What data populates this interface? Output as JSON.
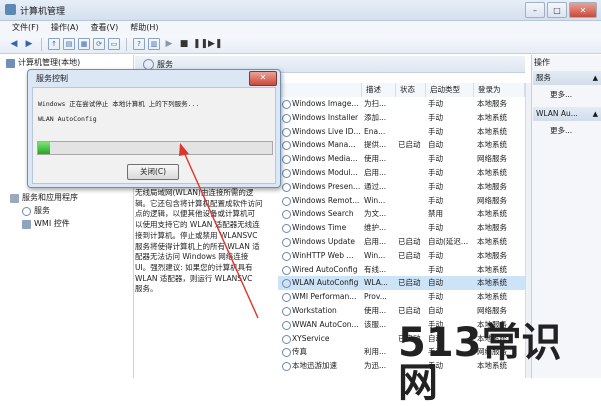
{
  "window": {
    "title": "计算机管理"
  },
  "menu": [
    "文件(F)",
    "操作(A)",
    "查看(V)",
    "帮助(H)"
  ],
  "tree": {
    "root": "计算机管理(本地)",
    "items": [
      "服务和应用程序",
      "服务",
      "WMI 控件"
    ]
  },
  "services_panel": {
    "header": "服务",
    "description": [
      "无线局域网(WLAN)由连接所需的逻",
      "辑。它还包含将计算机配置成软件访问",
      "点的逻辑，以便其他设备或计算机可",
      "以使用支持它的 WLAN 适配器无线连",
      "接到计算机。停止或禁用 WLANSVC",
      "服务将使得计算机上的所有 WLAN 适",
      "配器无法访问 Windows 网络连接",
      "UI。强烈建议: 如果您的计算机具有",
      "WLAN 适配器，则运行 WLANSVC",
      "服务。"
    ],
    "columns": [
      "描述",
      "状态",
      "启动类型",
      "登录为"
    ]
  },
  "services": [
    {
      "name": "Windows Image...",
      "desc": "为扫...",
      "status": "",
      "startup": "手动",
      "logon": "本地服务"
    },
    {
      "name": "Windows Installer",
      "desc": "添加...",
      "status": "",
      "startup": "手动",
      "logon": "本地系统"
    },
    {
      "name": "Windows Live ID...",
      "desc": "Ena...",
      "status": "",
      "startup": "手动",
      "logon": "本地系统"
    },
    {
      "name": "Windows Mana...",
      "desc": "提供...",
      "status": "已启动",
      "startup": "自动",
      "logon": "本地系统"
    },
    {
      "name": "Windows Media...",
      "desc": "使用...",
      "status": "",
      "startup": "手动",
      "logon": "网络服务"
    },
    {
      "name": "Windows Modul...",
      "desc": "启用...",
      "status": "",
      "startup": "手动",
      "logon": "本地系统"
    },
    {
      "name": "Windows Presen...",
      "desc": "通过...",
      "status": "",
      "startup": "手动",
      "logon": "本地服务"
    },
    {
      "name": "Windows Remot...",
      "desc": "Win...",
      "status": "",
      "startup": "手动",
      "logon": "网络服务"
    },
    {
      "name": "Windows Search",
      "desc": "为文...",
      "status": "",
      "startup": "禁用",
      "logon": "本地系统"
    },
    {
      "name": "Windows Time",
      "desc": "维护...",
      "status": "",
      "startup": "手动",
      "logon": "本地服务"
    },
    {
      "name": "Windows Update",
      "desc": "启用...",
      "status": "已启动",
      "startup": "自动(延迟...",
      "logon": "本地系统"
    },
    {
      "name": "WinHTTP Web ...",
      "desc": "Win...",
      "status": "已启动",
      "startup": "手动",
      "logon": "本地服务"
    },
    {
      "name": "Wired AutoConfig",
      "desc": "有线...",
      "status": "",
      "startup": "手动",
      "logon": "本地系统"
    },
    {
      "name": "WLAN AutoConfig",
      "desc": "WLA...",
      "status": "已启动",
      "startup": "自动",
      "logon": "本地系统"
    },
    {
      "name": "WMI Performan...",
      "desc": "Prov...",
      "status": "",
      "startup": "手动",
      "logon": "本地系统"
    },
    {
      "name": "Workstation",
      "desc": "使用...",
      "status": "已启动",
      "startup": "自动",
      "logon": "网络服务"
    },
    {
      "name": "WWAN AutoCon...",
      "desc": "该服...",
      "status": "",
      "startup": "手动",
      "logon": "本地服务"
    },
    {
      "name": "XYService",
      "desc": "",
      "status": "已启动",
      "startup": "自动",
      "logon": "本地系统"
    },
    {
      "name": "传真",
      "desc": "利用...",
      "status": "",
      "startup": "手动",
      "logon": "网络服务"
    },
    {
      "name": "本地迅游加速",
      "desc": "为迅...",
      "status": "",
      "startup": "手动",
      "logon": "本地系统"
    }
  ],
  "selected_service_index": 13,
  "actions": {
    "title": "操作",
    "group1": "服务",
    "more1": "更多...",
    "group2": "WLAN Au...",
    "more2": "更多..."
  },
  "dialog": {
    "title": "服务控制",
    "line1": "Windows 正在尝试停止 本地计算机 上的下列服务...",
    "line2": "WLAN AutoConfig",
    "progress": 0.05,
    "button": "关闭(C)"
  },
  "watermark": "513常识网",
  "colors": {
    "accent": "#3266a8",
    "selection": "#cde3f7",
    "arrow": "#e0332b",
    "progress": "#23a61f"
  }
}
